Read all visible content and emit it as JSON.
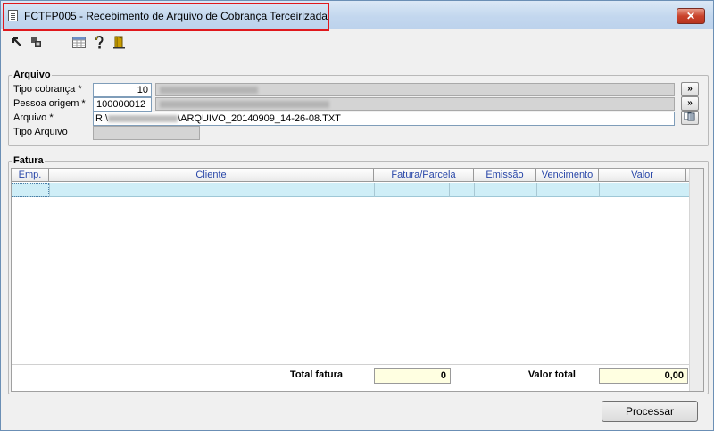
{
  "window": {
    "title": "FCTFP005 - Recebimento de Arquivo de Cobrança Terceirizada",
    "close_glyph": "✕"
  },
  "toolbar": {
    "icons": [
      "arrow-back-icon",
      "windows-icon",
      "grid-icon",
      "help-icon",
      "exit-door-icon"
    ]
  },
  "arquivo": {
    "group_title": "Arquivo",
    "tipo_cobranca_label": "Tipo cobrança *",
    "tipo_cobranca_value": "10",
    "pessoa_origem_label": "Pessoa origem *",
    "pessoa_origem_value": "100000012",
    "arquivo_label": "Arquivo *",
    "arquivo_path_prefix": "R:\\",
    "arquivo_path_suffix": "\\ARQUIVO_20140909_14-26-08.TXT",
    "tipo_arquivo_label": "Tipo Arquivo",
    "lookup_glyph": "»"
  },
  "fatura": {
    "group_title": "Fatura",
    "columns": [
      "Emp.",
      "Cliente",
      "Fatura/Parcela",
      "Emissão",
      "Vencimento",
      "Valor"
    ],
    "total_fatura_label": "Total fatura",
    "total_fatura_value": "0",
    "valor_total_label": "Valor total",
    "valor_total_value": "0,00"
  },
  "actions": {
    "processar_label": "Processar"
  },
  "colors": {
    "title_highlight": "#e0181c",
    "row_selected": "#cfeef7",
    "total_bg": "#ffffe1",
    "header_text": "#2846a8"
  }
}
